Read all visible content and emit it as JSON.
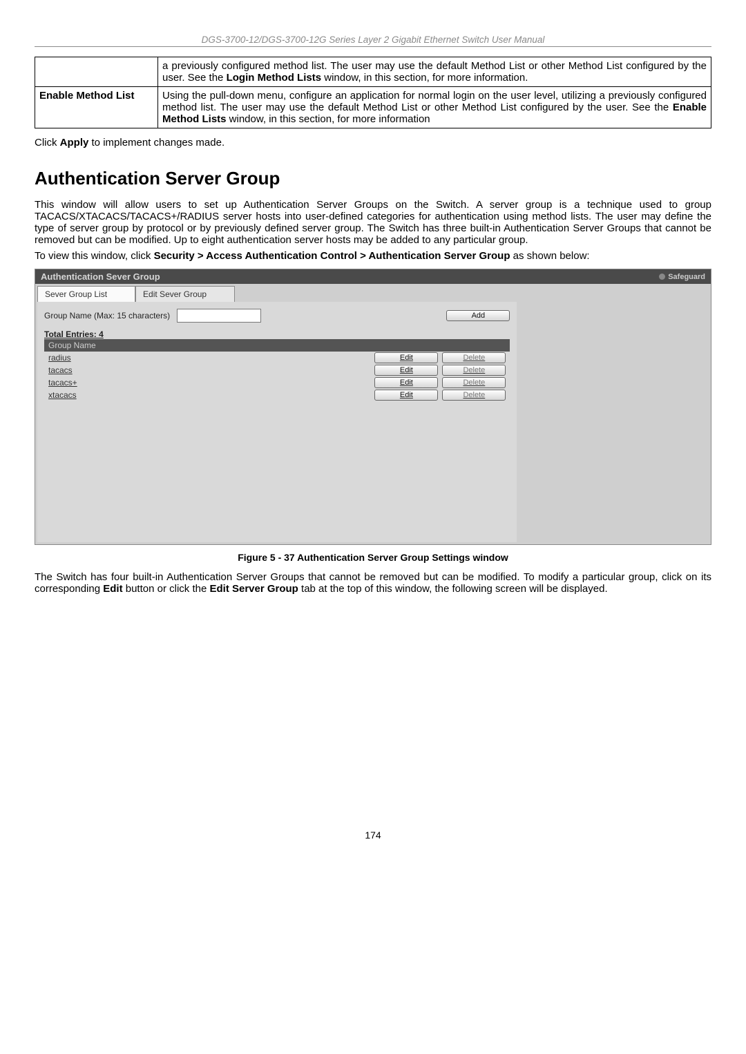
{
  "header_line": "DGS-3700-12/DGS-3700-12G Series Layer 2 Gigabit Ethernet Switch User Manual",
  "table": {
    "row1": {
      "desc_a": "a previously configured method list. The user may use the default Method List or other Method List configured by the user. See the ",
      "desc_bold": "Login Method Lists",
      "desc_b": " window, in this section, for more information."
    },
    "row2": {
      "label": "Enable Method List",
      "desc_a": "Using the pull-down menu, configure an application for normal login on the user level, utilizing a previously configured method list. The user may use the default Method List or other Method List configured by the user. See the ",
      "desc_bold": "Enable Method Lists",
      "desc_b": " window, in this section, for more information"
    }
  },
  "apply_line_a": "Click ",
  "apply_bold": "Apply",
  "apply_line_b": " to implement changes made.",
  "section_title": "Authentication Server Group",
  "para1": "This window will allow users to set up Authentication Server Groups on the Switch. A server group is a technique used to group TACACS/XTACACS/TACACS+/RADIUS server hosts into user-defined categories for authentication using method lists. The user may define the type of server group by protocol or by previously defined server group. The Switch has three built-in Authentication Server Groups that cannot be removed but can be modified. Up to eight authentication server hosts may be added to any particular group.",
  "para2_a": "To view this window, click ",
  "para2_bold": "Security > Access Authentication Control > Authentication Server Group",
  "para2_b": " as shown below:",
  "panel": {
    "title": "Authentication Sever Group",
    "safeguard": "Safeguard",
    "tab_list": "Sever Group List",
    "tab_edit": "Edit Sever Group",
    "field_label": "Group Name  (Max: 15 characters)",
    "add_btn": "Add",
    "total_entries": "Total Entries: 4",
    "col_header": "Group Name",
    "rows": [
      "radius",
      "tacacs",
      "tacacs+",
      "xtacacs"
    ],
    "edit": "Edit",
    "delete": "Delete"
  },
  "figure_caption": "Figure 5 - 37 Authentication Server Group Settings window",
  "para3_a": "The Switch has four built-in Authentication Server Groups that cannot be removed but can be modified. To modify a particular group, click on its corresponding ",
  "para3_bold1": "Edit",
  "para3_mid": " button or click the ",
  "para3_bold2": "Edit Server Group",
  "para3_b": " tab at the top of this window, the following screen will be displayed.",
  "page_number": "174"
}
